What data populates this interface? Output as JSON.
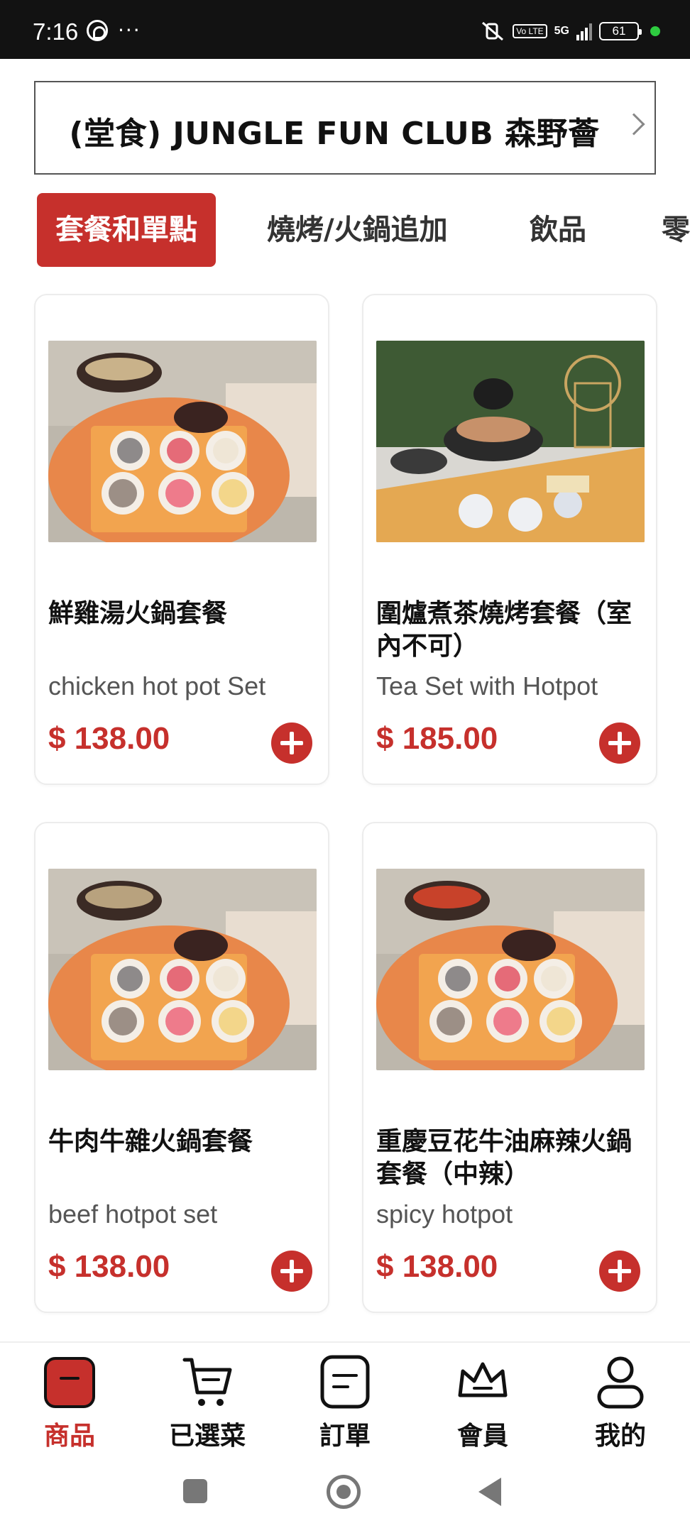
{
  "status_bar": {
    "time": "7:16",
    "battery": "61",
    "network": "5G",
    "volte": "Vo LTE",
    "dots": "···"
  },
  "store": {
    "title": "(堂食) JUNGLE FUN CLUB 森野薈"
  },
  "tabs": [
    {
      "label": "套餐和單點",
      "active": true
    },
    {
      "label": "燒烤/火鍋追加",
      "active": false
    },
    {
      "label": "飲品",
      "active": false
    },
    {
      "label": "零",
      "active": false
    }
  ],
  "products": [
    {
      "name": "鮮雞湯火鍋套餐",
      "en": "chicken hot pot Set",
      "price": "$ 138.00",
      "image": "chicken-hotpot-photo"
    },
    {
      "name": "圍爐煮茶燒烤套餐（室內不可）",
      "en": "Tea Set with Hotpot",
      "price": "$ 185.00",
      "image": "tea-bbq-photo"
    },
    {
      "name": "牛肉牛雜火鍋套餐",
      "en": "beef hotpot set",
      "price": "$ 138.00",
      "image": "beef-hotpot-photo"
    },
    {
      "name": "重慶豆花牛油麻辣火鍋套餐（中辣）",
      "en": "spicy hotpot",
      "price": "$ 138.00",
      "image": "spicy-hotpot-photo"
    }
  ],
  "bottom_nav": [
    {
      "label": "商品",
      "icon": "shop-bag-icon",
      "active": true
    },
    {
      "label": "已選菜",
      "icon": "cart-icon",
      "active": false
    },
    {
      "label": "訂單",
      "icon": "order-list-icon",
      "active": false
    },
    {
      "label": "會員",
      "icon": "crown-icon",
      "active": false
    },
    {
      "label": "我的",
      "icon": "user-icon",
      "active": false
    }
  ],
  "colors": {
    "accent": "#c6302c",
    "statusbar": "#121212"
  }
}
